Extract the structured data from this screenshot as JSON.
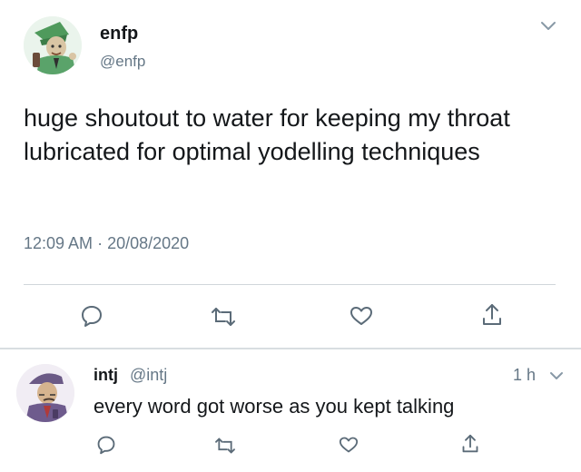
{
  "tweet": {
    "author_name": "enfp",
    "author_handle": "@enfp",
    "text": "huge shoutout to water for keeping my throat lubricated for optimal yodelling techniques",
    "time": "12:09 AM",
    "separator": "·",
    "date": "20/08/2020",
    "actions": [
      "reply-icon",
      "retweet-icon",
      "like-icon",
      "share-icon"
    ]
  },
  "reply": {
    "author_name": "intj",
    "author_handle": "@intj",
    "time_ago": "1 h",
    "text": "every word got worse as you kept talking",
    "actions": [
      "reply-icon",
      "retweet-icon",
      "like-icon",
      "share-icon"
    ]
  },
  "colors": {
    "text": "#14171a",
    "secondary": "#657786",
    "divider": "#d0d6db"
  }
}
